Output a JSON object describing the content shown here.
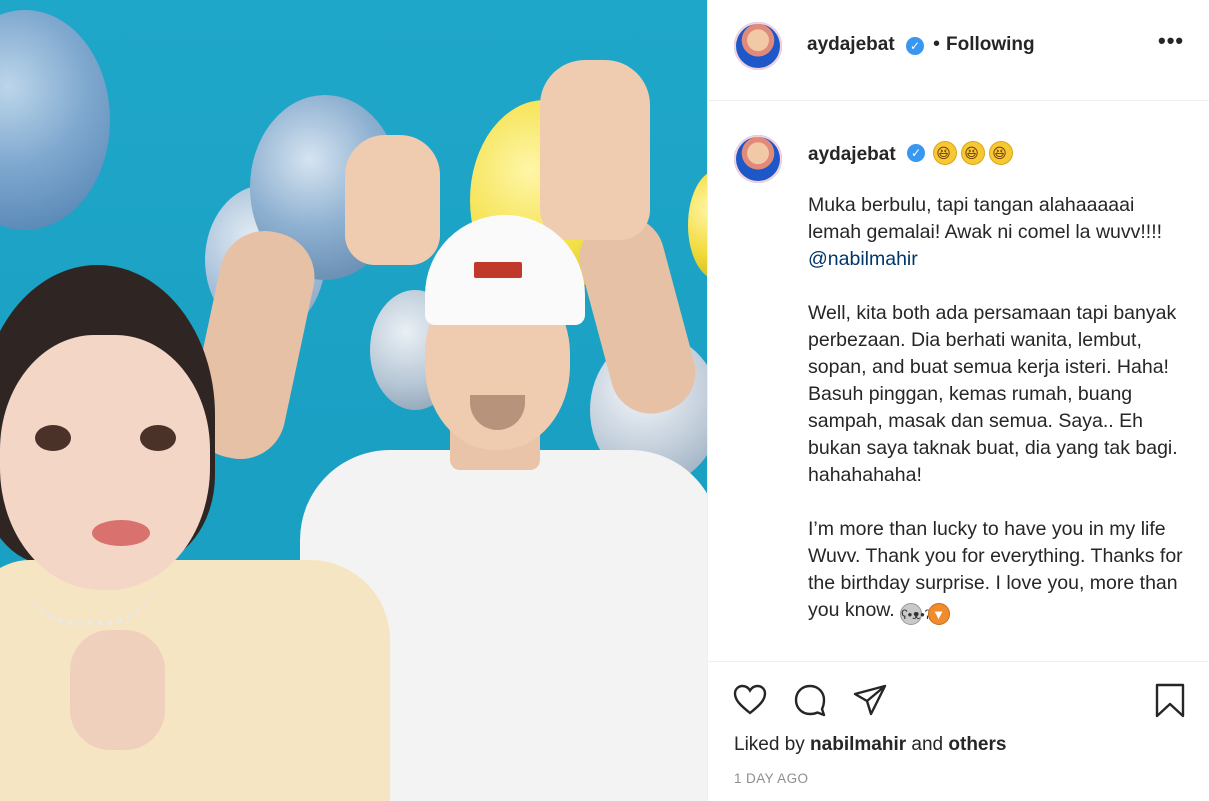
{
  "post": {
    "username": "aydajebat",
    "following_label": "Following",
    "separator": "•",
    "more_label": "•••",
    "verified_mark": "✓"
  },
  "caption": {
    "username": "aydajebat",
    "emojis": [
      "rolling-on-floor-laughing",
      "rolling-on-floor-laughing",
      "rolling-on-floor-laughing"
    ],
    "para1_text": "Muka berbulu, tapi tangan alahaaaaai lemah gemalai! Awak ni comel la wuvv!!!! ",
    "para1_mention": "@nabilmahir",
    "para2": "Well, kita both ada persamaan tapi banyak perbezaan. Dia berhati wanita, lembut, sopan, and buat semua kerja isteri. Haha! Basuh pinggan, kemas rumah, buang sampah, masak dan semua. Saya.. Eh bukan saya taknak buat, dia yang tak bagi. hahahahaha!",
    "para3": "I’m more than lucky to have you in my life Wuvv. Thank you for everything. Thanks for the birthday surprise. I love you, more than you know. ",
    "para3_emojis": [
      "koala",
      "fox"
    ]
  },
  "actions": {
    "icons": [
      "heart-icon",
      "comment-icon",
      "share-icon",
      "bookmark-icon"
    ]
  },
  "likes": {
    "prefix": "Liked by ",
    "user": "nabilmahir",
    "and": " and ",
    "others": "others"
  },
  "timestamp": "1 DAY AGO",
  "colors": {
    "verified": "#3897f0",
    "mention": "#00376b",
    "border": "#efefef",
    "timestamp": "#8e8e8e"
  }
}
